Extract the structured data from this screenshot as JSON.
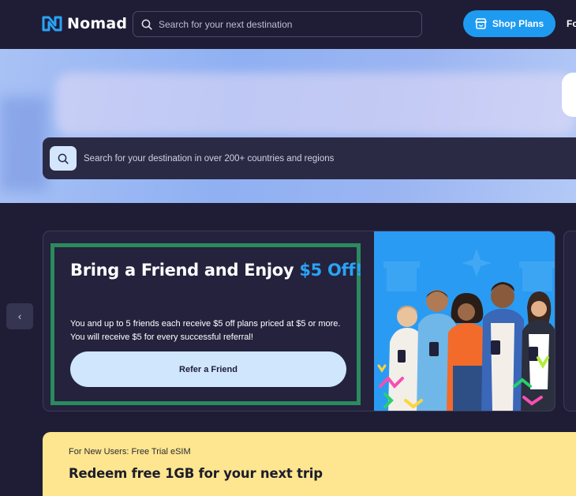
{
  "header": {
    "logo_text": "Nomad",
    "search_placeholder": "Search for your next destination",
    "shop_plans_label": "Shop Plans",
    "nav_cut_label": "Fo"
  },
  "hero": {
    "search_placeholder": "Search for your destination in over 200+ countries and regions"
  },
  "promo": {
    "prev_label": "‹",
    "title_main": "Bring a Friend and Enjoy ",
    "title_accent": "$5 Off!",
    "description": "You and up to 5 friends each receive $5 off plans priced at $5 or more. You will receive $5 for every successful referral!",
    "button_label": "Refer a Friend"
  },
  "trial": {
    "kicker": "For New Users: Free Trial eSIM",
    "headline": "Redeem free 1GB for your next trip"
  },
  "colors": {
    "background": "#1f1d36",
    "accent_blue": "#1e9bf0",
    "highlight_border": "#2b8a5e",
    "trial_yellow": "#fde68f",
    "button_light": "#cfe6fd"
  },
  "icons": {
    "logo": "nomad-logo-icon",
    "search": "search-icon",
    "shop": "store-icon",
    "prev": "chevron-left-icon"
  }
}
